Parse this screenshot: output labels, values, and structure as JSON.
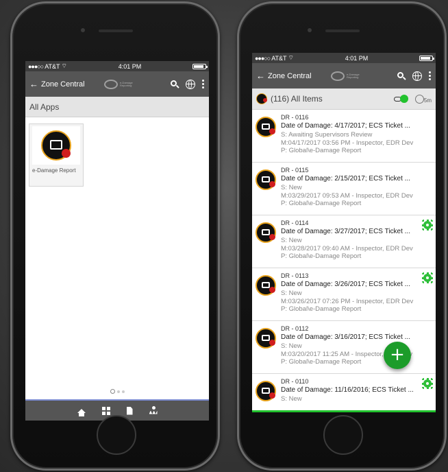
{
  "status": {
    "carrier": "AT&T",
    "time": "4:01 PM"
  },
  "appbar": {
    "back_label": "Zone Central",
    "brand_line1": "e-Damage",
    "brand_line2": "Reporting"
  },
  "left": {
    "section_title": "All Apps",
    "tile_label": "e-Damage Report"
  },
  "right": {
    "list_count": "(116) All Items",
    "refresh_interval": "5m",
    "items": [
      {
        "id": "DR - 0116",
        "title": "Date of Damage: 4/17/2017; ECS Ticket ...",
        "status": "S: Awaiting Supervisors Review",
        "modified": "M:04/17/2017 03:56 PM - Inspector, EDR Dev",
        "path": "P: Global\\e-Damage Report",
        "gear": false
      },
      {
        "id": "DR - 0115",
        "title": "Date of Damage: 2/15/2017; ECS Ticket ...",
        "status": "S: New",
        "modified": "M:03/29/2017 09:53 AM - Inspector, EDR Dev",
        "path": "P: Global\\e-Damage Report",
        "gear": false
      },
      {
        "id": "DR - 0114",
        "title": "Date of Damage: 3/27/2017; ECS Ticket ...",
        "status": "S: New",
        "modified": "M:03/28/2017 09:40 AM - Inspector, EDR Dev",
        "path": "P: Global\\e-Damage Report",
        "gear": true
      },
      {
        "id": "DR - 0113",
        "title": "Date of Damage: 3/26/2017; ECS Ticket ...",
        "status": "S: New",
        "modified": "M:03/26/2017 07:26 PM - Inspector, EDR Dev",
        "path": "P: Global\\e-Damage Report",
        "gear": true
      },
      {
        "id": "DR - 0112",
        "title": "Date of Damage: 3/16/2017; ECS Ticket ...",
        "status": "S: New",
        "modified": "M:03/20/2017 11:25 AM - Inspector, EDR Dev",
        "path": "P: Global\\e-Damage Report",
        "gear": false
      },
      {
        "id": "DR - 0110",
        "title": "Date of Damage: 11/16/2016; ECS Ticket ...",
        "status": "S: New",
        "modified": "",
        "path": "",
        "gear": true
      }
    ],
    "fab_label": "+"
  }
}
